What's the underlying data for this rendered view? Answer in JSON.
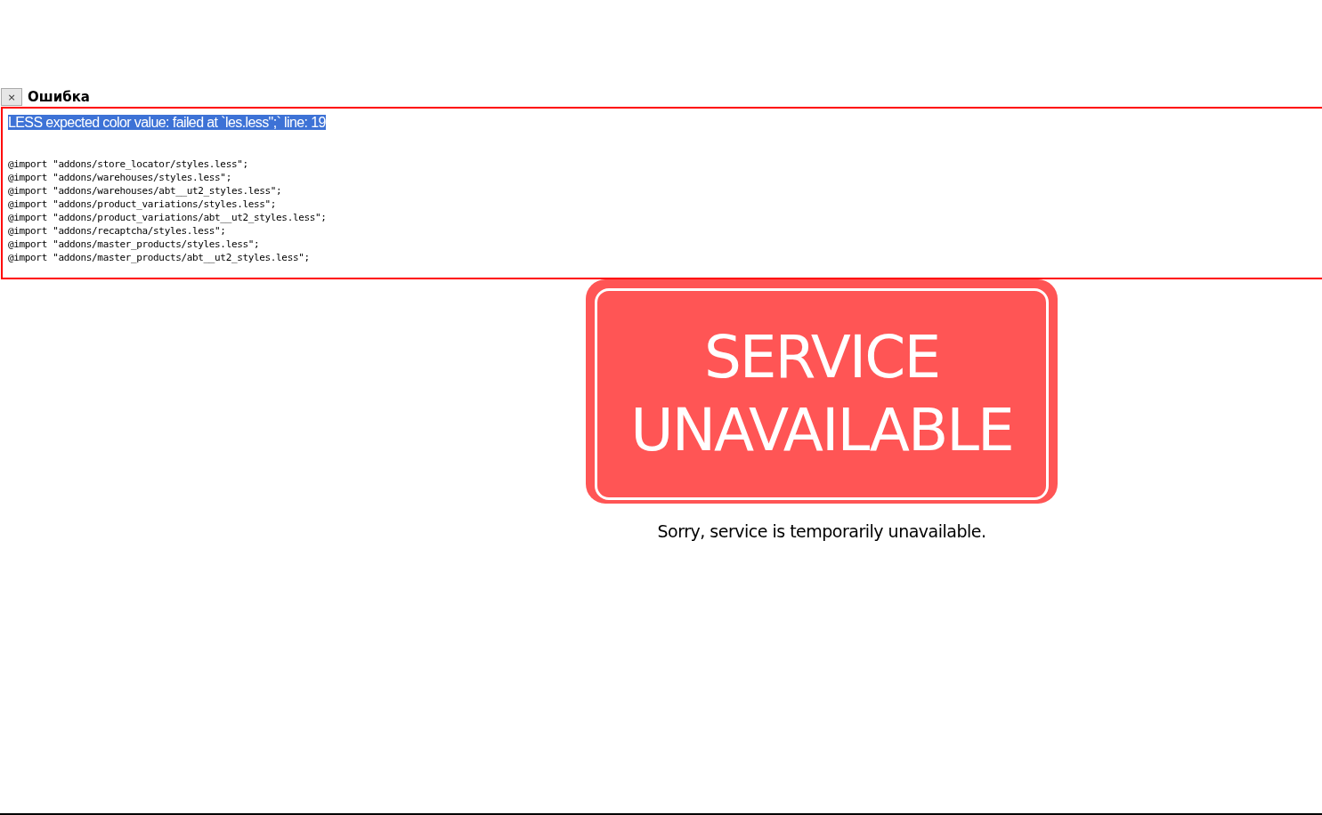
{
  "error_panel": {
    "close_button": "×",
    "title": "Ошибка",
    "message": {
      "text": "LESS expected color value: failed at `les.less\";` line: 19",
      "highlighted": true
    },
    "code_lines": [
      "@import \"addons/store_locator/styles.less\";",
      "@import \"addons/warehouses/styles.less\";",
      "@import \"addons/warehouses/abt__ut2_styles.less\";",
      "@import \"addons/product_variations/styles.less\";",
      "@import \"addons/product_variations/abt__ut2_styles.less\";",
      "@import \"addons/recaptcha/styles.less\";",
      "@import \"addons/master_products/styles.less\";",
      "@import \"addons/master_products/abt__ut2_styles.less\";"
    ]
  },
  "notice": {
    "sign_lines": [
      "SERVICE",
      "UNAVAILABLE"
    ],
    "message": "Sorry, service is temporarily unavailable."
  }
}
